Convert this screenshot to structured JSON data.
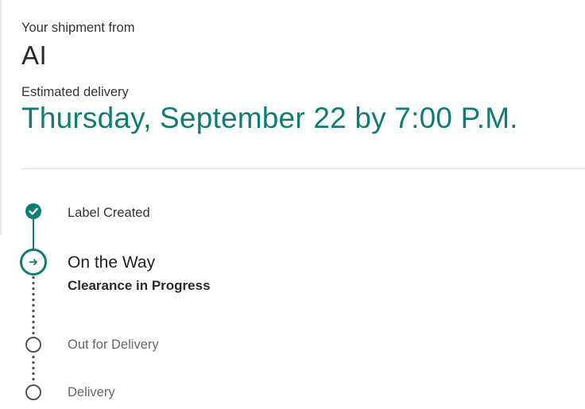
{
  "shipment": {
    "from_label": "Your shipment from",
    "sender": "AI",
    "estimate_label": "Estimated delivery",
    "estimate_value": "Thursday, September 22 by 7:00 P.M."
  },
  "timeline": {
    "steps": [
      {
        "label": "Label Created",
        "status": "done",
        "icon": "check-icon"
      },
      {
        "label": "On the Way",
        "status": "current",
        "sub_label": "Clearance in Progress",
        "icon": "arrow-right-icon"
      },
      {
        "label": "Out for Delivery",
        "status": "pending"
      },
      {
        "label": "Delivery",
        "status": "pending"
      }
    ]
  },
  "colors": {
    "accent": "#0f7d76",
    "pending": "#555555",
    "divider": "#e3e3e3"
  }
}
